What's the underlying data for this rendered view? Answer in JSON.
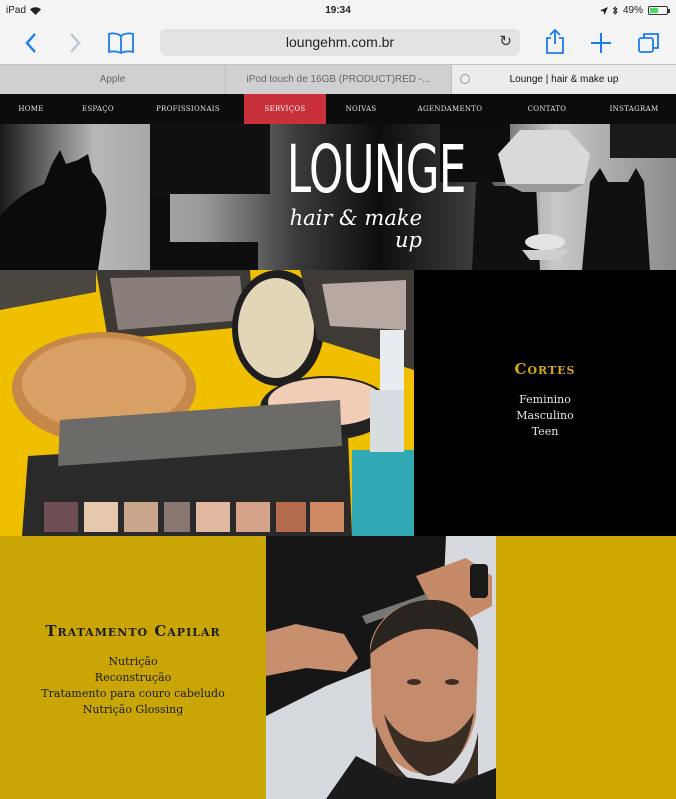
{
  "status_bar": {
    "device": "iPad",
    "time": "19:34",
    "battery": "49%",
    "battery_level": 0.49
  },
  "toolbar": {
    "back_icon": "chevron-left-icon",
    "forward_icon": "chevron-right-icon",
    "bookmarks_icon": "book-icon",
    "url": "loungehm.com.br",
    "reload_icon": "reload-icon",
    "share_icon": "share-icon",
    "new_tab_icon": "plus-icon",
    "tabs_icon": "tabs-icon"
  },
  "tabs": [
    {
      "label": "Apple",
      "active": false
    },
    {
      "label": "iPod touch de 16GB (PRODUCT)RED -...",
      "active": false
    },
    {
      "label": "Lounge | hair & make up",
      "active": true
    }
  ],
  "site_nav": {
    "items": [
      {
        "label": "HOME"
      },
      {
        "label": "ESPAÇO"
      },
      {
        "label": "PROFISSIONAIS"
      },
      {
        "label": "SERVIÇOS"
      },
      {
        "label": "NOIVAS"
      },
      {
        "label": "AGENDAMENTO"
      },
      {
        "label": "CONTATO"
      },
      {
        "label": "INSTAGRAM"
      }
    ],
    "active_index": 3,
    "active_color": "#c8303a"
  },
  "banner": {
    "brand": "LOUNGE",
    "tagline": "hair & make up"
  },
  "services": {
    "cortes": {
      "title": "Cortes",
      "items": [
        "Feminino",
        "Masculino",
        "Teen"
      ]
    },
    "tratamento": {
      "title": "Tratamento Capilar",
      "items": [
        "Nutrição",
        "Reconstrução",
        "Tratamento para couro cabeludo",
        "Nutrição Glossing"
      ]
    }
  },
  "colors": {
    "accent_yellow": "#c9a505",
    "nav_active_red": "#c8303a",
    "safari_blue": "#1a7cf2"
  }
}
